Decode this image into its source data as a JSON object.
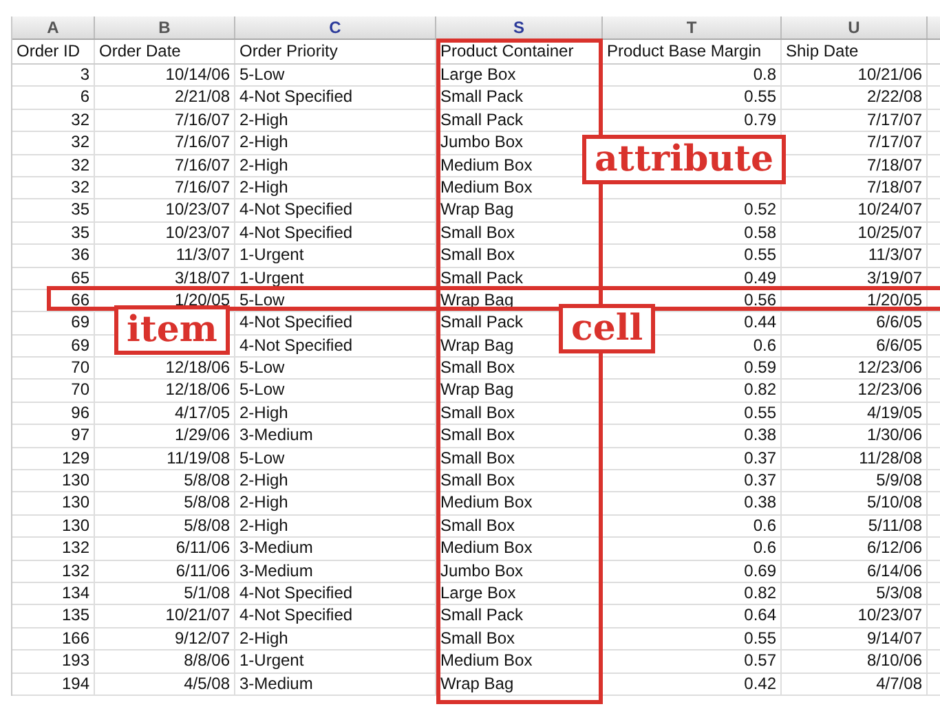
{
  "columns": [
    {
      "letter": "A",
      "header": "Order ID",
      "selected": false,
      "outlined": false
    },
    {
      "letter": "B",
      "header": "Order Date",
      "selected": false,
      "outlined": false
    },
    {
      "letter": "C",
      "header": "Order Priority",
      "selected": true,
      "outlined": false
    },
    {
      "letter": "S",
      "header": "Product Container",
      "selected": true,
      "outlined": true
    },
    {
      "letter": "T",
      "header": "Product Base Margin",
      "selected": false,
      "outlined": false
    },
    {
      "letter": "U",
      "header": "Ship Date",
      "selected": false,
      "outlined": false
    }
  ],
  "rows": [
    {
      "outlined": false,
      "cells": [
        "3",
        "10/14/06",
        "5-Low",
        "Large Box",
        "0.8",
        "10/21/06"
      ]
    },
    {
      "outlined": false,
      "cells": [
        "6",
        "2/21/08",
        "4-Not Specified",
        "Small Pack",
        "0.55",
        "2/22/08"
      ]
    },
    {
      "outlined": false,
      "cells": [
        "32",
        "7/16/07",
        "2-High",
        "Small Pack",
        "0.79",
        "7/17/07"
      ]
    },
    {
      "outlined": false,
      "cells": [
        "32",
        "7/16/07",
        "2-High",
        "Jumbo Box",
        null,
        "7/17/07"
      ]
    },
    {
      "outlined": false,
      "cells": [
        "32",
        "7/16/07",
        "2-High",
        "Medium Box",
        null,
        "7/18/07"
      ]
    },
    {
      "outlined": false,
      "cells": [
        "32",
        "7/16/07",
        "2-High",
        "Medium Box",
        null,
        "7/18/07"
      ]
    },
    {
      "outlined": false,
      "cells": [
        "35",
        "10/23/07",
        "4-Not Specified",
        "Wrap Bag",
        "0.52",
        "10/24/07"
      ]
    },
    {
      "outlined": false,
      "cells": [
        "35",
        "10/23/07",
        "4-Not Specified",
        "Small Box",
        "0.58",
        "10/25/07"
      ]
    },
    {
      "outlined": false,
      "cells": [
        "36",
        "11/3/07",
        "1-Urgent",
        "Small Box",
        "0.55",
        "11/3/07"
      ]
    },
    {
      "outlined": false,
      "cells": [
        "65",
        "3/18/07",
        "1-Urgent",
        "Small Pack",
        "0.49",
        "3/19/07"
      ]
    },
    {
      "outlined": true,
      "cells": [
        "66",
        "1/20/05",
        "5-Low",
        "Wrap Bag",
        "0.56",
        "1/20/05"
      ]
    },
    {
      "outlined": false,
      "cells": [
        "69",
        null,
        "4-Not Specified",
        "Small Pack",
        "0.44",
        "6/6/05"
      ]
    },
    {
      "outlined": false,
      "cells": [
        "69",
        null,
        "4-Not Specified",
        "Wrap Bag",
        "0.6",
        "6/6/05"
      ]
    },
    {
      "outlined": false,
      "cells": [
        "70",
        "12/18/06",
        "5-Low",
        "Small Box",
        "0.59",
        "12/23/06"
      ]
    },
    {
      "outlined": false,
      "cells": [
        "70",
        "12/18/06",
        "5-Low",
        "Wrap Bag",
        "0.82",
        "12/23/06"
      ]
    },
    {
      "outlined": false,
      "cells": [
        "96",
        "4/17/05",
        "2-High",
        "Small Box",
        "0.55",
        "4/19/05"
      ]
    },
    {
      "outlined": false,
      "cells": [
        "97",
        "1/29/06",
        "3-Medium",
        "Small Box",
        "0.38",
        "1/30/06"
      ]
    },
    {
      "outlined": false,
      "cells": [
        "129",
        "11/19/08",
        "5-Low",
        "Small Box",
        "0.37",
        "11/28/08"
      ]
    },
    {
      "outlined": false,
      "cells": [
        "130",
        "5/8/08",
        "2-High",
        "Small Box",
        "0.37",
        "5/9/08"
      ]
    },
    {
      "outlined": false,
      "cells": [
        "130",
        "5/8/08",
        "2-High",
        "Medium Box",
        "0.38",
        "5/10/08"
      ]
    },
    {
      "outlined": false,
      "cells": [
        "130",
        "5/8/08",
        "2-High",
        "Small Box",
        "0.6",
        "5/11/08"
      ]
    },
    {
      "outlined": false,
      "cells": [
        "132",
        "6/11/06",
        "3-Medium",
        "Medium Box",
        "0.6",
        "6/12/06"
      ]
    },
    {
      "outlined": false,
      "cells": [
        "132",
        "6/11/06",
        "3-Medium",
        "Jumbo Box",
        "0.69",
        "6/14/06"
      ]
    },
    {
      "outlined": false,
      "cells": [
        "134",
        "5/1/08",
        "4-Not Specified",
        "Large Box",
        "0.82",
        "5/3/08"
      ]
    },
    {
      "outlined": false,
      "cells": [
        "135",
        "10/21/07",
        "4-Not Specified",
        "Small Pack",
        "0.64",
        "10/23/07"
      ]
    },
    {
      "outlined": false,
      "cells": [
        "166",
        "9/12/07",
        "2-High",
        "Small Box",
        "0.55",
        "9/14/07"
      ]
    },
    {
      "outlined": false,
      "cells": [
        "193",
        "8/8/06",
        "1-Urgent",
        "Medium Box",
        "0.57",
        "8/10/06"
      ]
    },
    {
      "outlined": false,
      "cells": [
        "194",
        "4/5/08",
        "3-Medium",
        "Wrap Bag",
        "0.42",
        "4/7/08"
      ]
    }
  ],
  "annotations": [
    {
      "kind": "column",
      "text": "attribute"
    },
    {
      "kind": "row",
      "text": "item"
    },
    {
      "kind": "cell",
      "text": "cell"
    }
  ]
}
